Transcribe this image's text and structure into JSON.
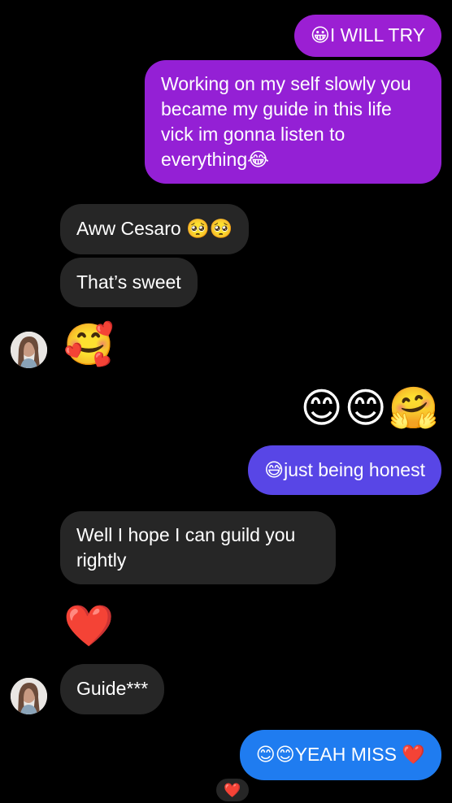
{
  "colors": {
    "background": "#000000",
    "received_bubble": "#262626",
    "sent_top": "#9b1fd3",
    "sent_mid": "#5846e6",
    "sent_bottom": "#1f7cf0"
  },
  "messages": [
    {
      "id": "m1",
      "direction": "sent",
      "text": "😀I WILL TRY"
    },
    {
      "id": "m2",
      "direction": "sent",
      "text": "Working on my self slowly you became my guide in this life vick im gonna listen to everything😂"
    },
    {
      "id": "m3",
      "direction": "received",
      "text": "Aww Cesaro 🥺🥺"
    },
    {
      "id": "m4",
      "direction": "received",
      "text": "That’s sweet"
    },
    {
      "id": "m5",
      "direction": "received",
      "text": "🥰",
      "emoji_only": true
    },
    {
      "id": "m6",
      "direction": "sent",
      "text": "😊😊🤗",
      "emoji_only": true
    },
    {
      "id": "m7",
      "direction": "sent",
      "text": "😅just being honest"
    },
    {
      "id": "m8",
      "direction": "received",
      "text": "Well I hope I can guild you rightly"
    },
    {
      "id": "m9",
      "direction": "received",
      "text": "❤️",
      "emoji_only": true
    },
    {
      "id": "m10",
      "direction": "received",
      "text": "Guide***"
    },
    {
      "id": "m11",
      "direction": "sent",
      "text": "😊😊YEAH MISS ❤️"
    }
  ],
  "reaction": {
    "emoji": "❤️"
  },
  "avatar_icon": "contact-avatar-photo"
}
